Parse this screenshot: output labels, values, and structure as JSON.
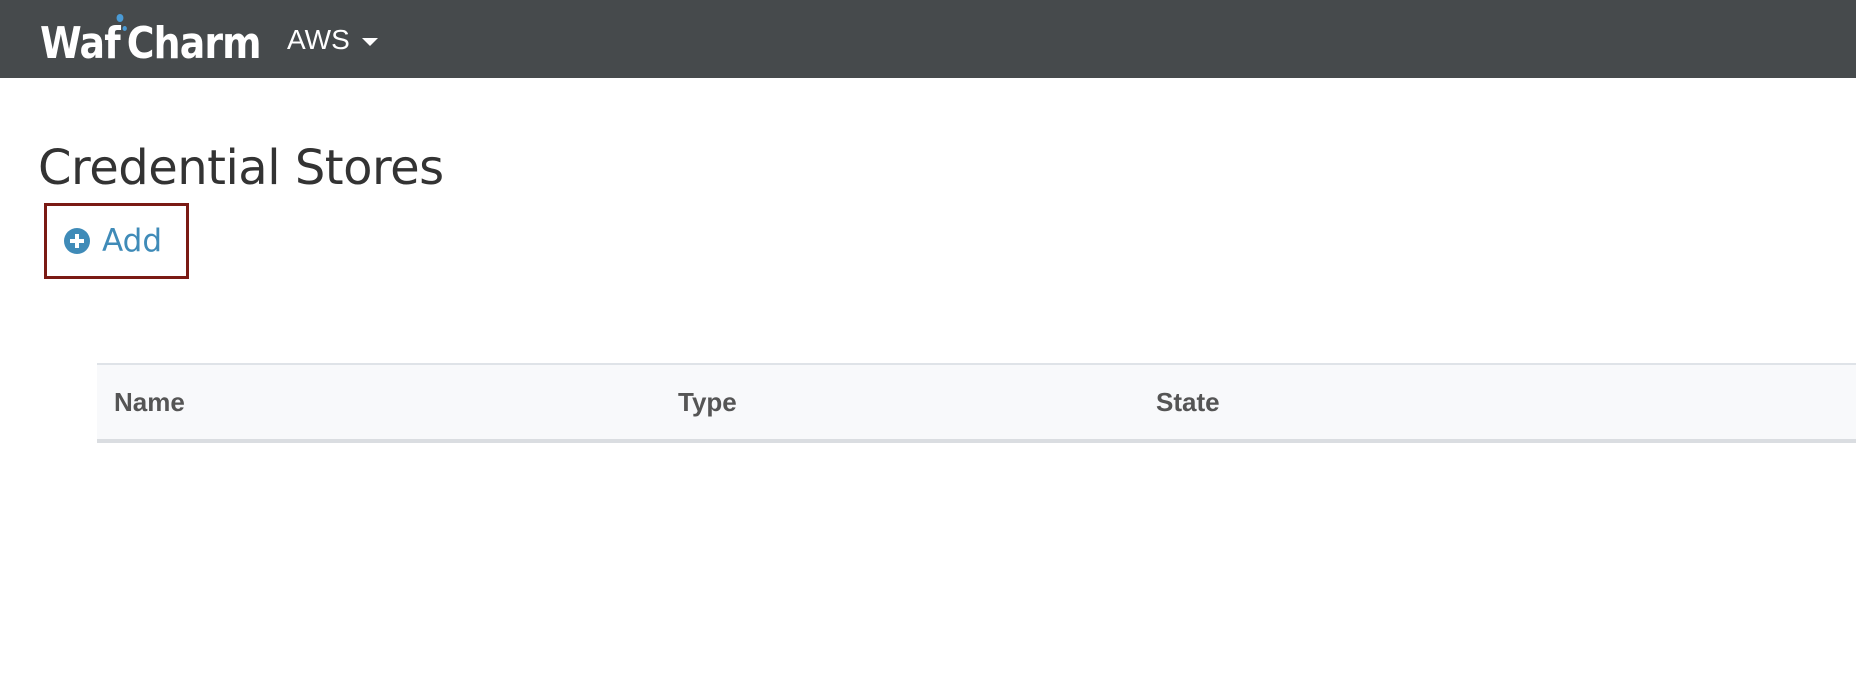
{
  "navbar": {
    "brand_left": "Waf",
    "brand_right": "Charm",
    "dropdown_label": "AWS"
  },
  "page": {
    "title": "Credential Stores"
  },
  "actions": {
    "add_label": "Add"
  },
  "table": {
    "columns": [
      "Name",
      "Type",
      "State"
    ]
  },
  "colors": {
    "navbar_bg": "#464a4c",
    "accent": "#3f8bb8",
    "brand_dot": "#4a9bd6",
    "highlight_border": "#7a1a14"
  },
  "icons": {
    "add": "plus-circle-icon",
    "dropdown": "caret-down-icon"
  }
}
